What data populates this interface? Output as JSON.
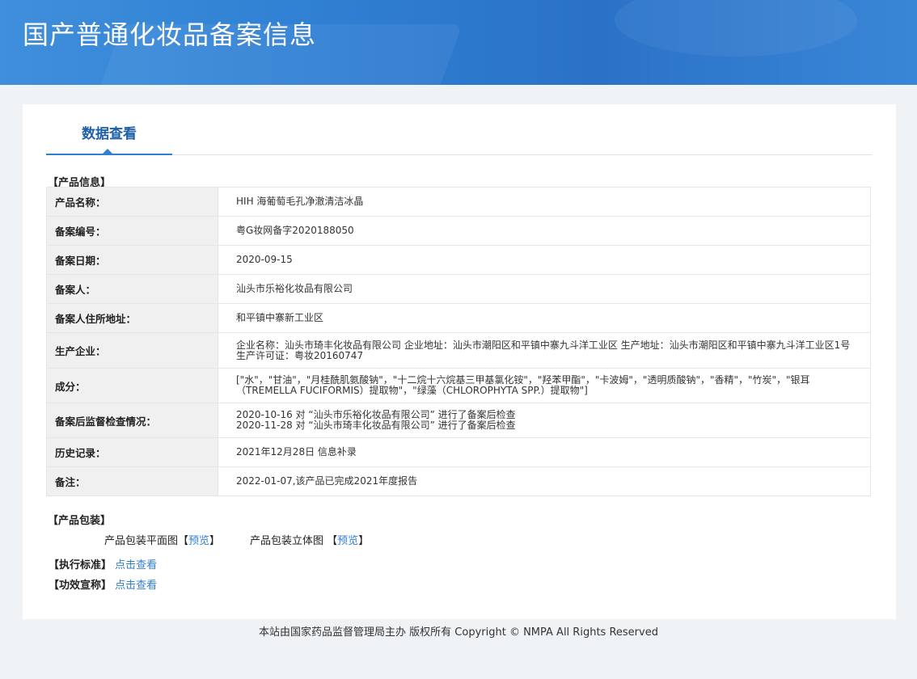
{
  "header": {
    "title": "国产普通化妆品备案信息"
  },
  "tabs": {
    "data_view": "数据查看"
  },
  "product_info": {
    "section_title": "【产品信息】",
    "rows": [
      {
        "label": "产品名称：",
        "value": "HIH 海葡萄毛孔净澈清洁冰晶"
      },
      {
        "label": "备案编号：",
        "value": "粤G妆网备字2020188050"
      },
      {
        "label": "备案日期：",
        "value": "2020-09-15"
      },
      {
        "label": "备案人：",
        "value": "汕头市乐裕化妆品有限公司"
      },
      {
        "label": "备案人住所地址：",
        "value": "和平镇中寨新工业区"
      },
      {
        "label": "生产企业：",
        "value": "企业名称：汕头市琦丰化妆品有限公司 企业地址：汕头市潮阳区和平镇中寨九斗洋工业区 生产地址：汕头市潮阳区和平镇中寨九斗洋工业区1号 生产许可证：粤妆20160747"
      },
      {
        "label": "成分：",
        "value": "[\"水\"，\"甘油\"，\"月桂酰肌氨酸钠\"，\"十二烷十六烷基三甲基氯化铵\"，\"羟苯甲酯\"，\"卡波姆\"，\"透明质酸钠\"，\"香精\"，\"竹炭\"，\"银耳（TREMELLA FUCIFORMIS）提取物\"，\"绿藻（CHLOROPHYTA SPP.）提取物\"]"
      },
      {
        "label": "备案后监督检查情况：",
        "lines": [
          "2020-10-16 对 “汕头市乐裕化妆品有限公司” 进行了备案后检查",
          "2020-11-28 对 “汕头市琦丰化妆品有限公司” 进行了备案后检查"
        ]
      },
      {
        "label": "历史记录：",
        "value": "2021年12月28日 信息补录"
      },
      {
        "label": "备注：",
        "value": "2022-01-07,该产品已完成2021年度报告"
      }
    ]
  },
  "packaging": {
    "section_title": "【产品包装】",
    "flat_label": "产品包装平面图",
    "three_d_label": "产品包装立体图",
    "open_bracket": "【",
    "close_bracket": "】",
    "preview_link": "预览"
  },
  "standard": {
    "label": "【执行标准】",
    "link": "点击查看"
  },
  "efficacy": {
    "label": "【功效宣称】",
    "link": "点击查看"
  },
  "footer": {
    "text": "本站由国家药品监督管理局主办 版权所有 Copyright © NMPA All Rights Reserved"
  }
}
